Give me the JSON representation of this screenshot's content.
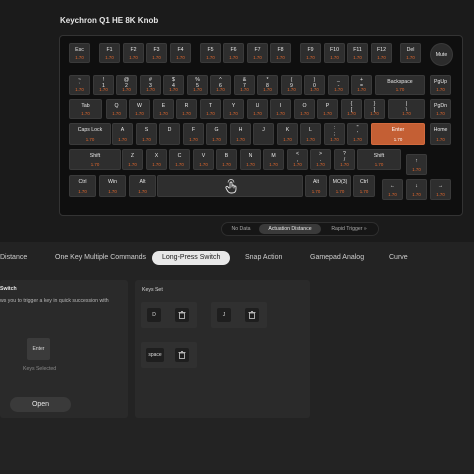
{
  "app": {
    "title": "Keychron Q1 HE 8K Knob"
  },
  "view_tabs": [
    "No Data",
    "Actuation Distance",
    "Rapid Trigger"
  ],
  "view_tabs_active": 1,
  "keyboard": {
    "keys": [
      {
        "id": "esc",
        "label": "Esc",
        "value": "1.70"
      },
      {
        "id": "f1",
        "label": "F1",
        "value": "1.70"
      },
      {
        "id": "f2",
        "label": "F2",
        "value": "1.70"
      },
      {
        "id": "f3",
        "label": "F3",
        "value": "1.70"
      },
      {
        "id": "f4",
        "label": "F4",
        "value": "1.70"
      },
      {
        "id": "f5",
        "label": "F5",
        "value": "1.70"
      },
      {
        "id": "f6",
        "label": "F6",
        "value": "1.70"
      },
      {
        "id": "f7",
        "label": "F7",
        "value": "1.70"
      },
      {
        "id": "f8",
        "label": "F8",
        "value": "1.70"
      },
      {
        "id": "f9",
        "label": "F9",
        "value": "1.70"
      },
      {
        "id": "f10",
        "label": "F10",
        "value": "1.70"
      },
      {
        "id": "f11",
        "label": "F11",
        "value": "1.70"
      },
      {
        "id": "f12",
        "label": "F12",
        "value": "1.70"
      },
      {
        "id": "del",
        "label": "Del",
        "value": "1.70"
      },
      {
        "id": "mute",
        "label": "Mute",
        "value": ""
      },
      {
        "id": "tilde",
        "label": "~\n`",
        "value": "1.70"
      },
      {
        "id": "n1",
        "label": "!\n1",
        "value": "1.70"
      },
      {
        "id": "n2",
        "label": "@\n2",
        "value": "1.70"
      },
      {
        "id": "n3",
        "label": "#\n3",
        "value": "1.70"
      },
      {
        "id": "n4",
        "label": "$\n4",
        "value": "1.70"
      },
      {
        "id": "n5",
        "label": "%\n5",
        "value": "1.70"
      },
      {
        "id": "n6",
        "label": "^\n6",
        "value": "1.70"
      },
      {
        "id": "n7",
        "label": "&\n7",
        "value": "1.70"
      },
      {
        "id": "n8",
        "label": "*\n8",
        "value": "1.70"
      },
      {
        "id": "n9",
        "label": "(\n9",
        "value": "1.70"
      },
      {
        "id": "n0",
        "label": ")\n0",
        "value": "1.70"
      },
      {
        "id": "minus",
        "label": "_\n-",
        "value": "1.70"
      },
      {
        "id": "equal",
        "label": "+\n=",
        "value": "1.70"
      },
      {
        "id": "backspace",
        "label": "Backspace",
        "value": "1.70"
      },
      {
        "id": "pgup",
        "label": "PgUp",
        "value": "1.70"
      },
      {
        "id": "tab",
        "label": "Tab",
        "value": "1.70"
      },
      {
        "id": "q",
        "label": "Q",
        "value": "1.70"
      },
      {
        "id": "w",
        "label": "W",
        "value": "1.70"
      },
      {
        "id": "e",
        "label": "E",
        "value": "1.70"
      },
      {
        "id": "r",
        "label": "R",
        "value": "1.70"
      },
      {
        "id": "t",
        "label": "T",
        "value": "1.70"
      },
      {
        "id": "y",
        "label": "Y",
        "value": "1.70"
      },
      {
        "id": "u",
        "label": "U",
        "value": "1.70"
      },
      {
        "id": "i",
        "label": "I",
        "value": "1.70"
      },
      {
        "id": "o",
        "label": "O",
        "value": "1.70"
      },
      {
        "id": "p",
        "label": "P",
        "value": "1.70"
      },
      {
        "id": "lbrace",
        "label": "{\n[",
        "value": "1.70"
      },
      {
        "id": "rbrace",
        "label": "}\n]",
        "value": "1.70"
      },
      {
        "id": "pipe",
        "label": "|\n\\",
        "value": "1.70"
      },
      {
        "id": "pgdn",
        "label": "PgDn",
        "value": "1.70"
      },
      {
        "id": "caps",
        "label": "Caps Lock",
        "value": "1.70"
      },
      {
        "id": "a",
        "label": "A",
        "value": "1.70"
      },
      {
        "id": "s",
        "label": "S",
        "value": "1.70"
      },
      {
        "id": "d",
        "label": "D",
        "value": ""
      },
      {
        "id": "f",
        "label": "F",
        "value": "1.70"
      },
      {
        "id": "g",
        "label": "G",
        "value": "1.70"
      },
      {
        "id": "h",
        "label": "H",
        "value": "1.70"
      },
      {
        "id": "j",
        "label": "J",
        "value": ""
      },
      {
        "id": "k",
        "label": "K",
        "value": "1.70"
      },
      {
        "id": "l",
        "label": "L",
        "value": "1.70"
      },
      {
        "id": "semicolon",
        "label": ":\n;",
        "value": "1.70"
      },
      {
        "id": "quote",
        "label": "\"\n'",
        "value": "1.70"
      },
      {
        "id": "enter",
        "label": "Enter",
        "value": "1.70"
      },
      {
        "id": "home",
        "label": "Home",
        "value": "1.70"
      },
      {
        "id": "lshift",
        "label": "Shift",
        "value": "1.70"
      },
      {
        "id": "z",
        "label": "Z",
        "value": "1.70"
      },
      {
        "id": "x",
        "label": "X",
        "value": "1.70"
      },
      {
        "id": "c",
        "label": "C",
        "value": "1.70"
      },
      {
        "id": "v",
        "label": "V",
        "value": "1.70"
      },
      {
        "id": "b",
        "label": "B",
        "value": "1.70"
      },
      {
        "id": "n",
        "label": "N",
        "value": "1.70"
      },
      {
        "id": "m",
        "label": "M",
        "value": "1.70"
      },
      {
        "id": "comma",
        "label": "<\n,",
        "value": "1.70"
      },
      {
        "id": "period",
        "label": ">\n.",
        "value": "1.70"
      },
      {
        "id": "slash",
        "label": "?\n/",
        "value": "1.70"
      },
      {
        "id": "rshift",
        "label": "Shift",
        "value": "1.70"
      },
      {
        "id": "up",
        "label": "↑",
        "value": "1.70"
      },
      {
        "id": "lctrl",
        "label": "Ctrl",
        "value": "1.70"
      },
      {
        "id": "lwin",
        "label": "Win",
        "value": "1.70"
      },
      {
        "id": "lalt",
        "label": "Alt",
        "value": "1.70"
      },
      {
        "id": "space",
        "label": "",
        "value": ""
      },
      {
        "id": "ralt",
        "label": "Alt",
        "value": "1.70"
      },
      {
        "id": "mo3",
        "label": "MO(3)",
        "value": "1.70"
      },
      {
        "id": "rctrl",
        "label": "Ctrl",
        "value": "1.70"
      },
      {
        "id": "left",
        "label": "←",
        "value": "1.70"
      },
      {
        "id": "down",
        "label": "↓",
        "value": "1.70"
      },
      {
        "id": "right",
        "label": "→",
        "value": "1.70"
      }
    ],
    "selected_key": "enter"
  },
  "modes": [
    "Distance",
    "One Key Multiple Commands",
    "Long-Press Switch",
    "Snap Action",
    "Gamepad Analog",
    "Curve"
  ],
  "mode_active": 2,
  "left_panel": {
    "title": "Switch",
    "description": "ws you to trigger a key in quick succession with",
    "selected_key": "Enter",
    "selected_caption": "Keys Selected",
    "open_button": "Open"
  },
  "keys_set": {
    "title": "Keys Set",
    "groups": [
      {
        "key": "D"
      },
      {
        "key": "J"
      },
      {
        "key": "space"
      }
    ]
  },
  "colors": {
    "accent": "#c45f34",
    "value_text": "#e0672d"
  }
}
